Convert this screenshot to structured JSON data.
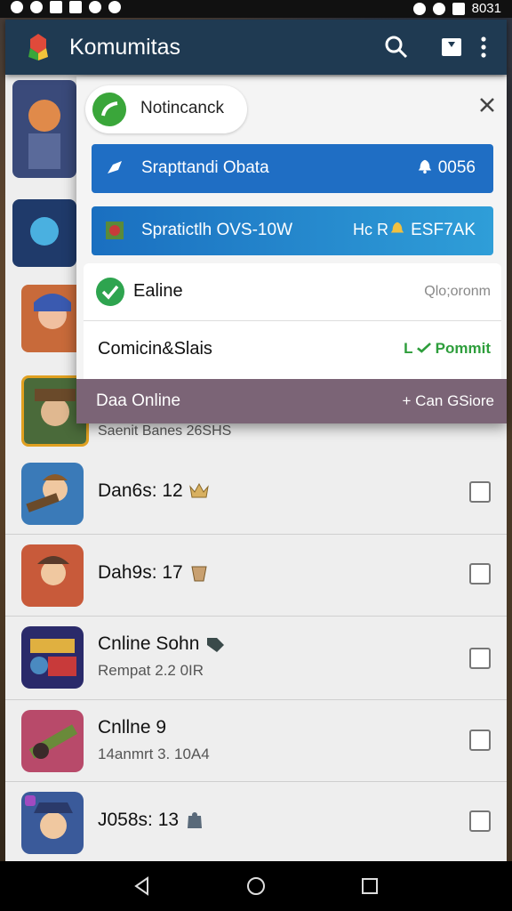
{
  "app": {
    "title": "Komumitas"
  },
  "status_bar": {
    "time": "8031"
  },
  "popup": {
    "notification": "Notincanck",
    "bars": [
      {
        "label": "Srapttandi Obata",
        "right": "0056"
      },
      {
        "label": "Spratictlh OVS-10W",
        "mid": "Hc R",
        "right": "ESF7AK"
      }
    ],
    "items": [
      {
        "label": "Ealine",
        "right": "Qlo;oronm"
      },
      {
        "label": "Comicin&Slais",
        "right": "Pommit",
        "right_prefix": "L"
      }
    ],
    "highlight": {
      "label": "Daa Online",
      "right": "+ Can GSiore"
    },
    "peek_sub": "Saenit Banes 26SHS"
  },
  "list": [
    {
      "title": "Dan6s: 12",
      "sub": ""
    },
    {
      "title": "Dah9s: 17",
      "sub": ""
    },
    {
      "title": "Cnline Sohn",
      "sub": "Rempat 2.2 0IR"
    },
    {
      "title": "Cnllne 9",
      "sub": "14anmrt 3. 10A4"
    },
    {
      "title": "J058s: 13",
      "sub": ""
    }
  ],
  "colors": {
    "appbar": "#1f3a52",
    "bar_blue": "#1f6ec4",
    "highlight": "#7b6476",
    "online_green": "#2ea44f"
  }
}
